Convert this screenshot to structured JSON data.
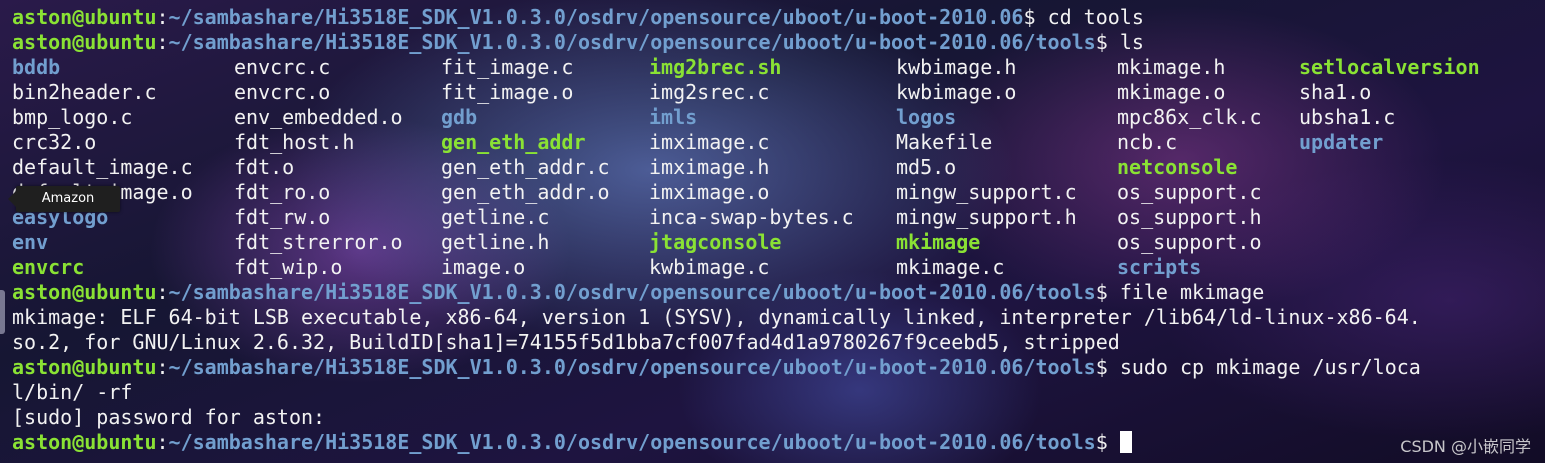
{
  "terminal": {
    "prompt": {
      "user_host": "aston@ubuntu",
      "separator": ":",
      "path_base": "~/sambashare/Hi3518E_SDK_V1.0.3.0/osdrv/opensource/uboot/u-boot-2010.06",
      "path_tools": "~/sambashare/Hi3518E_SDK_V1.0.3.0/osdrv/opensource/uboot/u-boot-2010.06/tools",
      "symbol": "$ "
    },
    "commands": {
      "cd": "cd tools",
      "ls": "ls",
      "file": "file mkimage",
      "sudo_line1": "sudo cp mkimage /usr/loca",
      "sudo_line2": "l/bin/ -rf"
    },
    "ls_columns": [
      [
        "bddb",
        "bin2header.c",
        "bmp_logo.c",
        "crc32.o",
        "default_image.c",
        "default_image.o",
        "easylogo",
        "env",
        "envcrc"
      ],
      [
        "envcrc.c",
        "envcrc.o",
        "env_embedded.o",
        "fdt_host.h",
        "fdt.o",
        "fdt_ro.o",
        "fdt_rw.o",
        "fdt_strerror.o",
        "fdt_wip.o"
      ],
      [
        "fit_image.c",
        "fit_image.o",
        "gdb",
        "gen_eth_addr",
        "gen_eth_addr.c",
        "gen_eth_addr.o",
        "getline.c",
        "getline.h",
        "image.o"
      ],
      [
        "img2brec.sh",
        "img2srec.c",
        "imls",
        "imximage.c",
        "imximage.h",
        "imximage.o",
        "inca-swap-bytes.c",
        "jtagconsole",
        "kwbimage.c"
      ],
      [
        "kwbimage.h",
        "kwbimage.o",
        "logos",
        "Makefile",
        "md5.o",
        "mingw_support.c",
        "mingw_support.h",
        "mkimage",
        "mkimage.c"
      ],
      [
        "mkimage.h",
        "mkimage.o",
        "mpc86x_clk.c",
        "ncb.c",
        "netconsole",
        "os_support.c",
        "os_support.h",
        "os_support.o",
        "scripts"
      ],
      [
        "setlocalversion",
        "sha1.o",
        "ubsha1.c",
        "updater"
      ]
    ],
    "ls_types": [
      [
        "d",
        "f",
        "f",
        "f",
        "f",
        "f",
        "d",
        "d",
        "x"
      ],
      [
        "f",
        "f",
        "f",
        "f",
        "f",
        "f",
        "f",
        "f",
        "f"
      ],
      [
        "f",
        "f",
        "d",
        "x",
        "f",
        "f",
        "f",
        "f",
        "f"
      ],
      [
        "x",
        "f",
        "d",
        "f",
        "f",
        "f",
        "f",
        "x",
        "f"
      ],
      [
        "f",
        "f",
        "d",
        "f",
        "f",
        "f",
        "f",
        "x",
        "f"
      ],
      [
        "f",
        "f",
        "f",
        "f",
        "x",
        "f",
        "f",
        "f",
        "d"
      ],
      [
        "x",
        "f",
        "f",
        "d"
      ]
    ],
    "output": {
      "file_line1": "mkimage: ELF 64-bit LSB executable, x86-64, version 1 (SYSV), dynamically linked, interpreter /lib64/ld-linux-x86-64.",
      "file_line2": "so.2, for GNU/Linux 2.6.32, BuildID[sha1]=74155f5d1bba7cf007fad4d1a9780267f9ceebd5, stripped",
      "sudo_prompt": "[sudo] password for aston:"
    }
  },
  "tooltip": {
    "label": "Amazon"
  },
  "watermark": {
    "text": "CSDN @小嵌同学"
  },
  "colors": {
    "user_host": "#8ae234",
    "path": "#729fcf",
    "text": "#f2f2f2",
    "directory": "#729fcf",
    "executable": "#8ae234"
  }
}
